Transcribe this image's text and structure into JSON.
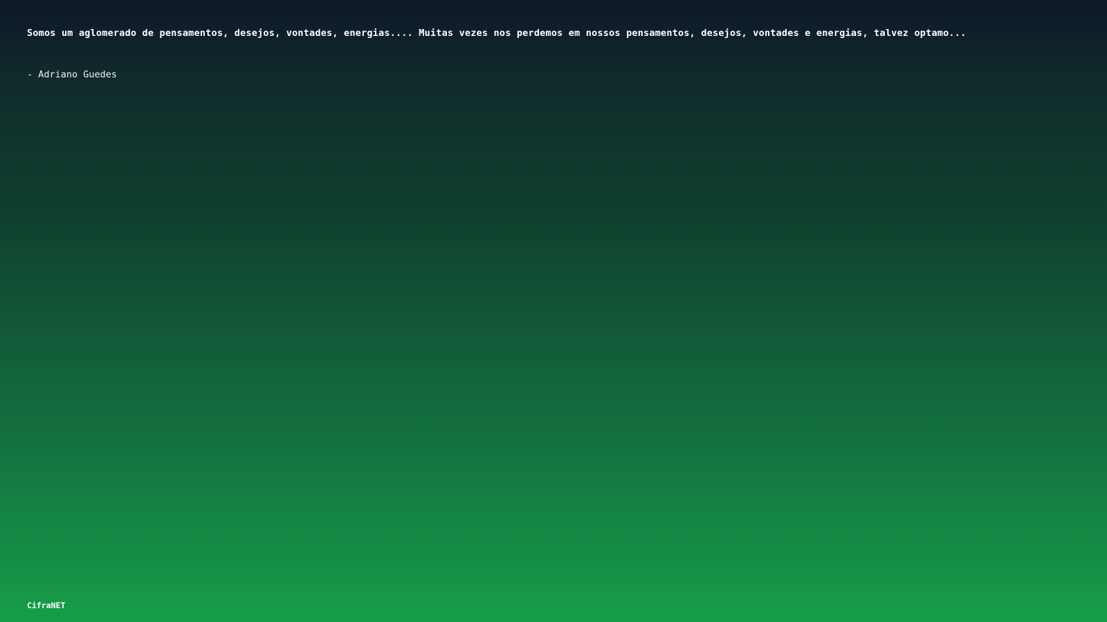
{
  "quote": {
    "text": "Somos um aglomerado de pensamentos, desejos, vontades, energias.... Muitas vezes nos perdemos em nossos pensamentos, desejos, vontades e energias, talvez optamo...",
    "author": "- Adriano Guedes"
  },
  "footer": {
    "brand": "CifraNET"
  },
  "colors": {
    "gradient_top": "#0f1729",
    "gradient_bottom": "#169e48",
    "text": "#ffffff"
  }
}
